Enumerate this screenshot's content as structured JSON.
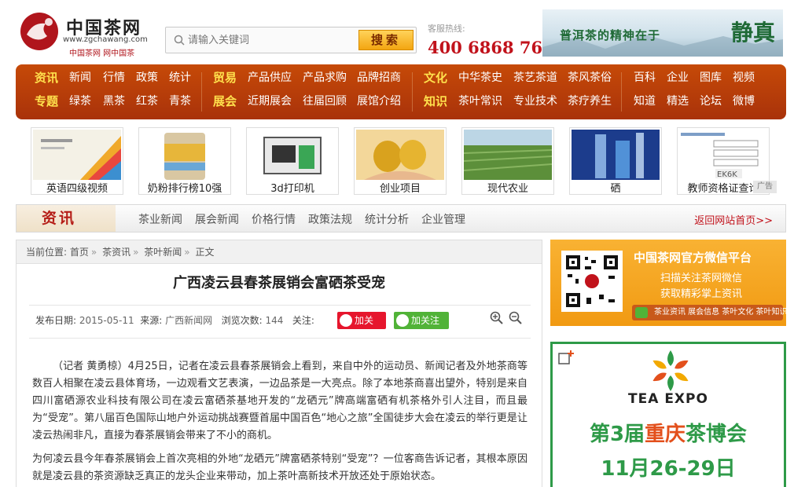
{
  "header": {
    "logo_name": "中国茶网",
    "logo_url": "www.zgchawang.com",
    "logo_sub": "中国茶网   网中国茶",
    "search_placeholder": "请输入关键词",
    "search_button": "搜索",
    "hotline_label": "客服热线:",
    "hotline_number": "400 6868 768",
    "banner_slogan": "普洱茶的精神在于",
    "banner_big": "静真"
  },
  "nav": {
    "row1": [
      "资讯",
      "新闻",
      "行情",
      "政策",
      "统计",
      "贸易",
      "产品供应",
      "产品求购",
      "品牌招商",
      "文化",
      "中华茶史",
      "茶艺茶道",
      "茶风茶俗",
      "百科",
      "企业",
      "图库",
      "视频"
    ],
    "row2": [
      "专题",
      "绿茶",
      "黑茶",
      "红茶",
      "青茶",
      "展会",
      "近期展会",
      "往届回顾",
      "展馆介绍",
      "知识",
      "茶叶常识",
      "专业技术",
      "茶疗养生",
      "知道",
      "精选",
      "论坛",
      "微博"
    ]
  },
  "ads": [
    {
      "caption": "英语四级视频"
    },
    {
      "caption": "奶粉排行榜10强"
    },
    {
      "caption": "3d打印机"
    },
    {
      "caption": "创业项目"
    },
    {
      "caption": "现代农业"
    },
    {
      "caption": "硒"
    },
    {
      "caption": "教师资格证查询"
    }
  ],
  "ad_badge": "广告",
  "channel": {
    "tag": "资讯",
    "links": [
      "茶业新闻",
      "展会新闻",
      "价格行情",
      "政策法规",
      "统计分析",
      "企业管理"
    ],
    "home_link": "返回网站首页>>"
  },
  "article": {
    "crumb_prefix": "当前位置:",
    "crumbs": [
      "首页",
      "茶资讯",
      "茶叶新闻",
      "正文"
    ],
    "title": "广西凌云县春茶展销会富硒茶受宠",
    "date_label": "发布日期:",
    "date": "2015-05-11",
    "source_label": "来源:",
    "source": "广西新闻网",
    "views_label": "浏览次数:",
    "views": "144",
    "follow_label": "关注:",
    "weibo_btn": "加关注",
    "wechat_btn": "加关注",
    "para1": "（记者 黄勇椋）4月25日，记者在凌云县春茶展销会上看到，来自中外的运动员、新闻记者及外地茶商等数百人相聚在凌云县体育场，一边观看文艺表演，一边品茶是一大亮点。除了本地茶商喜出望外，特别是来自四川富硒源农业科技有限公司在凌云富硒茶基地开发的“龙硒元”牌高端富硒有机茶格外引人注目，而且最为“受宠”。第八届百色国际山地户外运动挑战赛暨首届中国百色“地心之旅”全国徒步大会在凌云的举行更是让凌云热闹非凡，直接为春茶展销会带来了不小的商机。",
    "para2": "为何凌云县今年春茶展销会上首次亮相的外地“龙硒元”牌富硒茶特别“受宠”？一位客商告诉记者，其根本原因就是凌云县的茶资源缺乏真正的龙头企业来带动，加上茶叶高新技术开放还处于原始状态。"
  },
  "wechat_box": {
    "title": "中国茶网官方微信平台",
    "line1": "扫描关注茶网微信",
    "line2": "获取精彩掌上资讯",
    "strip": "茶业资讯  展会信息  茶叶文化  茶叶知识"
  },
  "expo": {
    "name": "TEA EXPO",
    "big_pre": "第3届",
    "big_accent": "重庆",
    "big_post": "茶博会",
    "date": "11月26-29日"
  }
}
